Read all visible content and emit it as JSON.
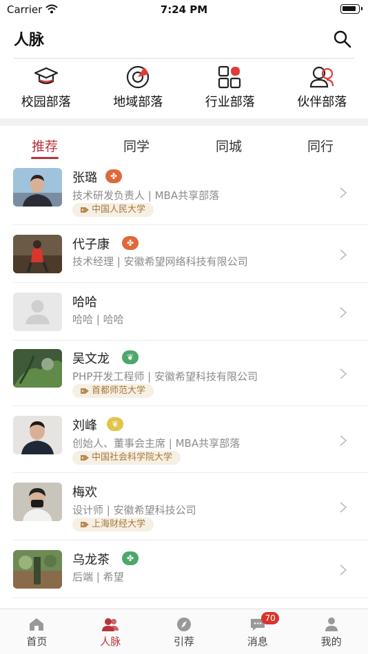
{
  "status_bar": {
    "carrier": "Carrier",
    "time": "7:24 PM"
  },
  "header": {
    "title": "人脉"
  },
  "tribes": [
    {
      "label": "校园部落",
      "icon": "graduation-cap-icon"
    },
    {
      "label": "地域部落",
      "icon": "target-icon"
    },
    {
      "label": "行业部落",
      "icon": "grid-icon"
    },
    {
      "label": "伙伴部落",
      "icon": "partners-icon"
    }
  ],
  "tabs": [
    {
      "label": "推荐",
      "active": true
    },
    {
      "label": "同学",
      "active": false
    },
    {
      "label": "同城",
      "active": false
    },
    {
      "label": "同行",
      "active": false
    }
  ],
  "people": [
    {
      "name": "张璐",
      "subtitle": "技术研发负责人 | MBA共享部落",
      "school": "中国人民大学",
      "badge_color": "#e0683a"
    },
    {
      "name": "代子康",
      "subtitle": "技术经理 | 安徽希望网络科技有限公司",
      "school": "",
      "badge_color": "#e0683a"
    },
    {
      "name": "哈哈",
      "subtitle": "哈哈 | 哈哈",
      "school": "",
      "badge_color": ""
    },
    {
      "name": "吴文龙",
      "subtitle": "PHP开发工程师 | 安徽希望科技有限公司",
      "school": "首都师范大学",
      "badge_color": "#4ca86a"
    },
    {
      "name": "刘峰",
      "subtitle": "创始人、董事会主席 | MBA共享部落",
      "school": "中国社会科学院大学",
      "badge_color": "#e2c44a"
    },
    {
      "name": "梅欢",
      "subtitle": "设计师 | 安徽希望科技公司",
      "school": "上海财经大学",
      "badge_color": ""
    },
    {
      "name": "乌龙茶",
      "subtitle": "后端 | 希望",
      "school": "",
      "badge_color": "#4ca86a"
    }
  ],
  "tabbar": [
    {
      "label": "首页",
      "icon": "home-icon",
      "active": false
    },
    {
      "label": "人脉",
      "icon": "contacts-icon",
      "active": true
    },
    {
      "label": "引荐",
      "icon": "compass-icon",
      "active": false
    },
    {
      "label": "消息",
      "icon": "message-icon",
      "active": false,
      "badge": "70"
    },
    {
      "label": "我的",
      "icon": "profile-icon",
      "active": false
    }
  ],
  "colors": {
    "accent": "#b8333a",
    "tag_bg": "#f6efe3",
    "tag_text": "#a6773b"
  }
}
